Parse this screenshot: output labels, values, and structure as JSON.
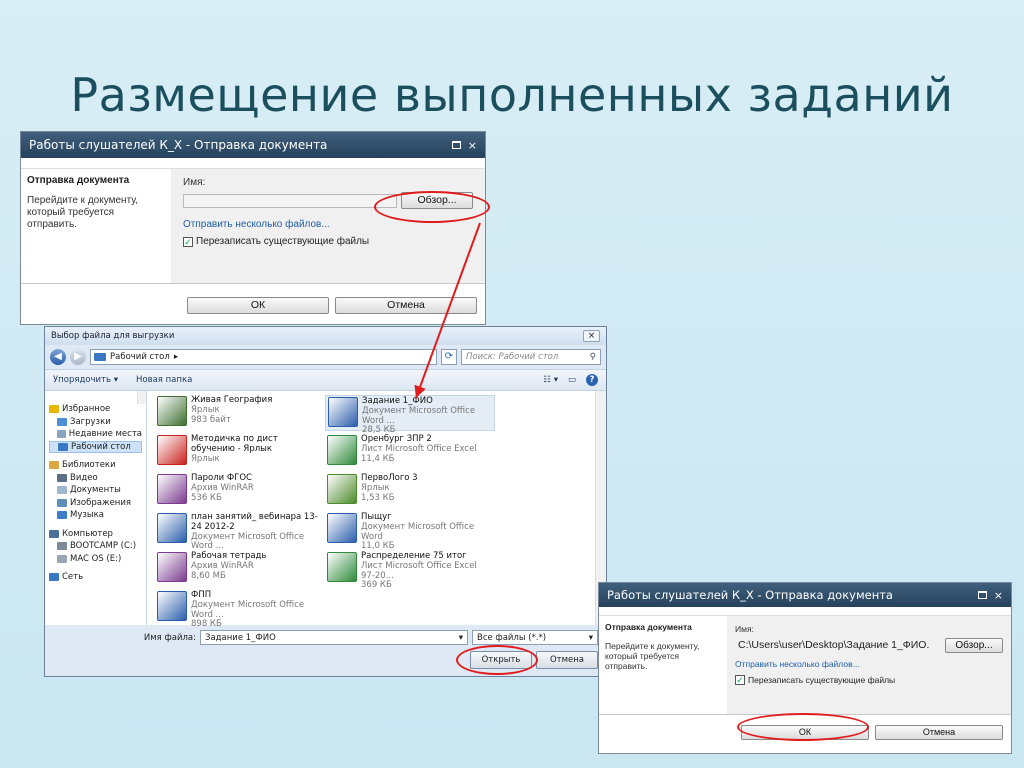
{
  "slide": {
    "title": "Размещение выполненных заданий"
  },
  "upload_dialog_top": {
    "title": "Работы слушателей К_Х - Отправка документа",
    "close_glyph": "×",
    "section_heading": "Отправка документа",
    "section_desc": "Перейдите к документу, который требуется отправить.",
    "name_label": "Имя:",
    "path_value": "",
    "browse_button": "Обзор...",
    "multi_link": "Отправить несколько файлов...",
    "overwrite_label": "Перезаписать существующие файлы",
    "overwrite_checked": true,
    "ok_button": "ОК",
    "cancel_button": "Отмена"
  },
  "file_dialog": {
    "title": "Выбор файла для выгрузки",
    "close_glyph": "×",
    "address": "Рабочий стол",
    "search_placeholder": "Поиск: Рабочий стол",
    "toolbar_organize": "Упорядочить ▾",
    "toolbar_new_folder": "Новая папка",
    "nav_items": [
      {
        "label": "Избранное",
        "icon": "star-icon",
        "color": "#e8b800",
        "group": true
      },
      {
        "label": "Загрузки",
        "icon": "downloads-icon",
        "color": "#4c8fd6"
      },
      {
        "label": "Недавние места",
        "icon": "recent-icon",
        "color": "#8aa4bf"
      },
      {
        "label": "Рабочий стол",
        "icon": "desktop-icon",
        "color": "#3a78c4",
        "selected": true
      },
      {
        "label": "Библиотеки",
        "icon": "libraries-icon",
        "color": "#d9a843",
        "group": true
      },
      {
        "label": "Видео",
        "icon": "video-icon",
        "color": "#5a6e84"
      },
      {
        "label": "Документы",
        "icon": "documents-icon",
        "color": "#9fb7cf"
      },
      {
        "label": "Изображения",
        "icon": "pictures-icon",
        "color": "#5f8fb8"
      },
      {
        "label": "Музыка",
        "icon": "music-icon",
        "color": "#3d7cc9"
      },
      {
        "label": "Компьютер",
        "icon": "computer-icon",
        "color": "#4a6f98",
        "group": true
      },
      {
        "label": "BOOTCAMP (C:)",
        "icon": "drive-icon",
        "color": "#7d8b99"
      },
      {
        "label": "MAC OS (E:)",
        "icon": "drive-icon",
        "color": "#9aa6b2"
      },
      {
        "label": "Сеть",
        "icon": "network-icon",
        "color": "#3a78c4",
        "group": true
      }
    ],
    "files": [
      {
        "name": "Живая География",
        "meta1": "Ярлык",
        "meta2": "983 байт",
        "icon": "globe-shortcut-icon",
        "color": "#3c6e2f"
      },
      {
        "name": "Задание 1_ФИО",
        "meta1": "Документ Microsoft Office Word ...",
        "meta2": "28,5 КБ",
        "icon": "word-doc-icon",
        "color": "#2b5eab",
        "selected": true
      },
      {
        "name": "Методичка по дист обучению - Ярлык",
        "meta1": "Ярлык",
        "meta2": "",
        "icon": "pdf-shortcut-icon",
        "color": "#c8231f"
      },
      {
        "name": "Оренбург ЗПР 2",
        "meta1": "Лист Microsoft Office Excel",
        "meta2": "11,4 КБ",
        "icon": "excel-doc-icon",
        "color": "#2f8a3b"
      },
      {
        "name": "Пароли ФГОС",
        "meta1": "Архив WinRAR",
        "meta2": "536 КБ",
        "icon": "winrar-icon",
        "color": "#7b3b8f"
      },
      {
        "name": "ПервоЛого 3",
        "meta1": "Ярлык",
        "meta2": "1,53 КБ",
        "icon": "turtle-shortcut-icon",
        "color": "#4c8a2b"
      },
      {
        "name": "план занятий_ вебинара 13-24 2012-2",
        "meta1": "Документ Microsoft Office Word ...",
        "meta2": "",
        "icon": "word-doc-icon",
        "color": "#2b5eab"
      },
      {
        "name": "Пыщуг",
        "meta1": "Документ Microsoft Office Word",
        "meta2": "11,0 КБ",
        "icon": "word-doc-icon",
        "color": "#2b5eab"
      },
      {
        "name": "Рабочая тетрадь",
        "meta1": "Архив WinRAR",
        "meta2": "8,60 МБ",
        "icon": "winrar-icon",
        "color": "#7b3b8f"
      },
      {
        "name": "Распределение 75 итог",
        "meta1": "Лист Microsoft Office Excel 97-20...",
        "meta2": "369 КБ",
        "icon": "excel-doc-icon",
        "color": "#2f8a3b"
      },
      {
        "name": "ФПП",
        "meta1": "Документ Microsoft Office Word ...",
        "meta2": "898 КБ",
        "icon": "word-doc-icon",
        "color": "#2b5eab"
      }
    ],
    "filename_label": "Имя файла:",
    "filename_value": "Задание 1_ФИО",
    "filter_value": "Все файлы (*.*)",
    "open_button": "Открыть",
    "cancel_button": "Отмена"
  },
  "upload_dialog_bottom": {
    "title": "Работы слушателей К_Х - Отправка документа",
    "close_glyph": "×",
    "section_heading": "Отправка документа",
    "section_desc": "Перейдите к документу, который требуется отправить.",
    "name_label": "Имя:",
    "path_value": "C:\\Users\\user\\Desktop\\Задание 1_ФИО.",
    "browse_button": "Обзор...",
    "multi_link": "Отправить несколько файлов...",
    "overwrite_label": "Перезаписать существующие файлы",
    "overwrite_checked": true,
    "ok_button": "ОК",
    "cancel_button": "Отмена"
  },
  "colors": {
    "accent_annotation": "#e01c1c",
    "title_text": "#1b4f5e",
    "titlebar": "#2f4d6a"
  }
}
